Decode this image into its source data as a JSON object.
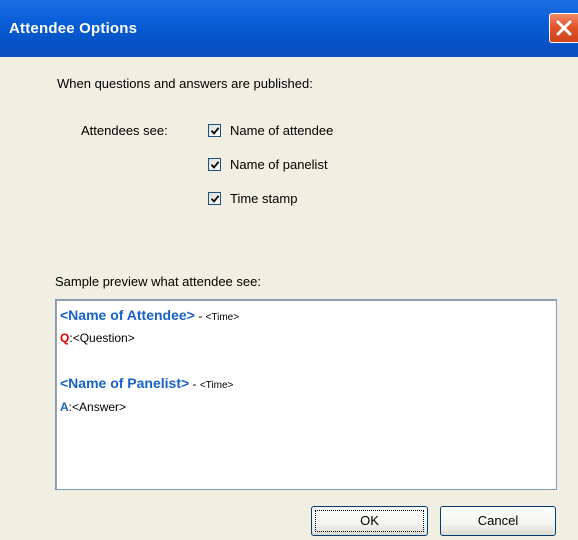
{
  "window": {
    "title": "Attendee Options",
    "close_icon": "close-icon",
    "accent_color": "#0a5fd8",
    "close_color": "#e2552b"
  },
  "intro_text": "When questions and answers are published:",
  "attendees_see_label": "Attendees see:",
  "options": [
    {
      "label": "Name of attendee",
      "checked": true
    },
    {
      "label": "Name of panelist",
      "checked": true
    },
    {
      "label": "Time stamp",
      "checked": true
    }
  ],
  "preview_label": "Sample preview what attendee see:",
  "preview": {
    "attendee_name": "<Name of Attendee>",
    "separator": " - ",
    "time": "<Time>",
    "q_letter": "Q",
    "colon": ":",
    "question": "<Question>",
    "panelist_name": "<Name of Panelist>",
    "a_letter": "A",
    "answer": "<Answer>",
    "name_color": "#1862c8",
    "q_color": "#e20000"
  },
  "buttons": {
    "ok_label": "OK",
    "cancel_label": "Cancel"
  }
}
